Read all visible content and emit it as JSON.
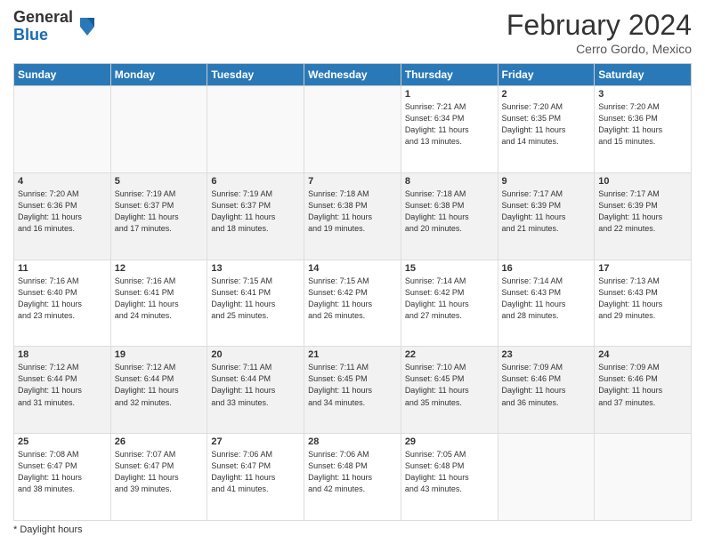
{
  "header": {
    "logo_general": "General",
    "logo_blue": "Blue",
    "month_title": "February 2024",
    "location": "Cerro Gordo, Mexico"
  },
  "days_of_week": [
    "Sunday",
    "Monday",
    "Tuesday",
    "Wednesday",
    "Thursday",
    "Friday",
    "Saturday"
  ],
  "weeks": [
    [
      {
        "day": "",
        "info": ""
      },
      {
        "day": "",
        "info": ""
      },
      {
        "day": "",
        "info": ""
      },
      {
        "day": "",
        "info": ""
      },
      {
        "day": "1",
        "info": "Sunrise: 7:21 AM\nSunset: 6:34 PM\nDaylight: 11 hours\nand 13 minutes."
      },
      {
        "day": "2",
        "info": "Sunrise: 7:20 AM\nSunset: 6:35 PM\nDaylight: 11 hours\nand 14 minutes."
      },
      {
        "day": "3",
        "info": "Sunrise: 7:20 AM\nSunset: 6:36 PM\nDaylight: 11 hours\nand 15 minutes."
      }
    ],
    [
      {
        "day": "4",
        "info": "Sunrise: 7:20 AM\nSunset: 6:36 PM\nDaylight: 11 hours\nand 16 minutes."
      },
      {
        "day": "5",
        "info": "Sunrise: 7:19 AM\nSunset: 6:37 PM\nDaylight: 11 hours\nand 17 minutes."
      },
      {
        "day": "6",
        "info": "Sunrise: 7:19 AM\nSunset: 6:37 PM\nDaylight: 11 hours\nand 18 minutes."
      },
      {
        "day": "7",
        "info": "Sunrise: 7:18 AM\nSunset: 6:38 PM\nDaylight: 11 hours\nand 19 minutes."
      },
      {
        "day": "8",
        "info": "Sunrise: 7:18 AM\nSunset: 6:38 PM\nDaylight: 11 hours\nand 20 minutes."
      },
      {
        "day": "9",
        "info": "Sunrise: 7:17 AM\nSunset: 6:39 PM\nDaylight: 11 hours\nand 21 minutes."
      },
      {
        "day": "10",
        "info": "Sunrise: 7:17 AM\nSunset: 6:39 PM\nDaylight: 11 hours\nand 22 minutes."
      }
    ],
    [
      {
        "day": "11",
        "info": "Sunrise: 7:16 AM\nSunset: 6:40 PM\nDaylight: 11 hours\nand 23 minutes."
      },
      {
        "day": "12",
        "info": "Sunrise: 7:16 AM\nSunset: 6:41 PM\nDaylight: 11 hours\nand 24 minutes."
      },
      {
        "day": "13",
        "info": "Sunrise: 7:15 AM\nSunset: 6:41 PM\nDaylight: 11 hours\nand 25 minutes."
      },
      {
        "day": "14",
        "info": "Sunrise: 7:15 AM\nSunset: 6:42 PM\nDaylight: 11 hours\nand 26 minutes."
      },
      {
        "day": "15",
        "info": "Sunrise: 7:14 AM\nSunset: 6:42 PM\nDaylight: 11 hours\nand 27 minutes."
      },
      {
        "day": "16",
        "info": "Sunrise: 7:14 AM\nSunset: 6:43 PM\nDaylight: 11 hours\nand 28 minutes."
      },
      {
        "day": "17",
        "info": "Sunrise: 7:13 AM\nSunset: 6:43 PM\nDaylight: 11 hours\nand 29 minutes."
      }
    ],
    [
      {
        "day": "18",
        "info": "Sunrise: 7:12 AM\nSunset: 6:44 PM\nDaylight: 11 hours\nand 31 minutes."
      },
      {
        "day": "19",
        "info": "Sunrise: 7:12 AM\nSunset: 6:44 PM\nDaylight: 11 hours\nand 32 minutes."
      },
      {
        "day": "20",
        "info": "Sunrise: 7:11 AM\nSunset: 6:44 PM\nDaylight: 11 hours\nand 33 minutes."
      },
      {
        "day": "21",
        "info": "Sunrise: 7:11 AM\nSunset: 6:45 PM\nDaylight: 11 hours\nand 34 minutes."
      },
      {
        "day": "22",
        "info": "Sunrise: 7:10 AM\nSunset: 6:45 PM\nDaylight: 11 hours\nand 35 minutes."
      },
      {
        "day": "23",
        "info": "Sunrise: 7:09 AM\nSunset: 6:46 PM\nDaylight: 11 hours\nand 36 minutes."
      },
      {
        "day": "24",
        "info": "Sunrise: 7:09 AM\nSunset: 6:46 PM\nDaylight: 11 hours\nand 37 minutes."
      }
    ],
    [
      {
        "day": "25",
        "info": "Sunrise: 7:08 AM\nSunset: 6:47 PM\nDaylight: 11 hours\nand 38 minutes."
      },
      {
        "day": "26",
        "info": "Sunrise: 7:07 AM\nSunset: 6:47 PM\nDaylight: 11 hours\nand 39 minutes."
      },
      {
        "day": "27",
        "info": "Sunrise: 7:06 AM\nSunset: 6:47 PM\nDaylight: 11 hours\nand 41 minutes."
      },
      {
        "day": "28",
        "info": "Sunrise: 7:06 AM\nSunset: 6:48 PM\nDaylight: 11 hours\nand 42 minutes."
      },
      {
        "day": "29",
        "info": "Sunrise: 7:05 AM\nSunset: 6:48 PM\nDaylight: 11 hours\nand 43 minutes."
      },
      {
        "day": "",
        "info": ""
      },
      {
        "day": "",
        "info": ""
      }
    ]
  ],
  "footer": {
    "note": "Daylight hours"
  }
}
